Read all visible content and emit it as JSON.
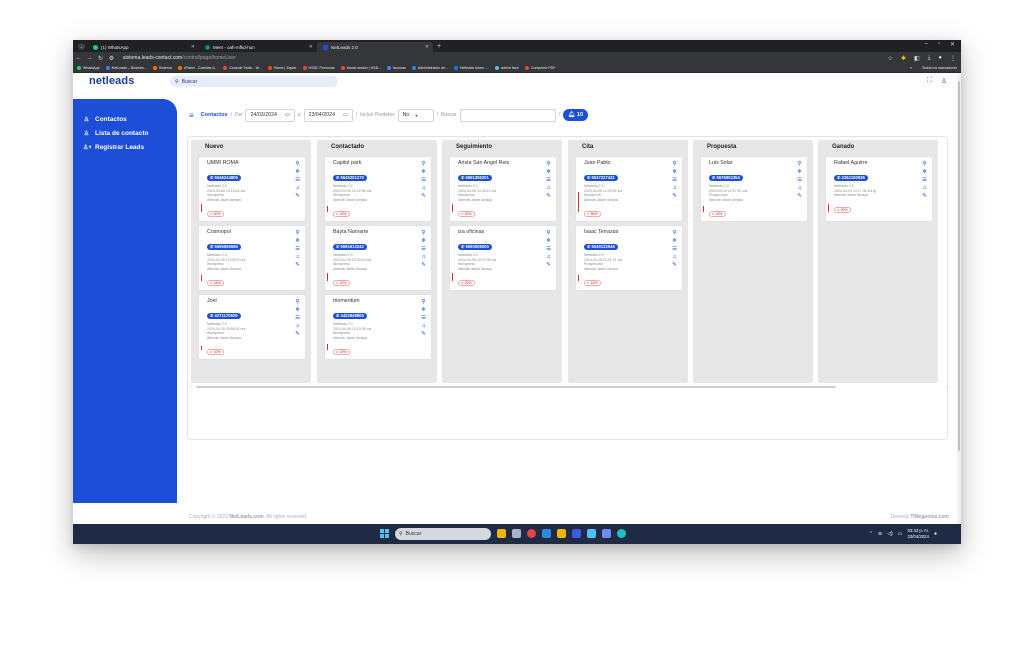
{
  "browser": {
    "tabs": [
      {
        "label": "(1) WhatsApp"
      },
      {
        "label": "Meet - oah-mfkd-hun"
      },
      {
        "label": "NetLeads 2.0"
      }
    ],
    "url_host": "sistema.leads-contact.com",
    "url_path": "/control/page/homeUser",
    "bookmarks": [
      "WhatsApp",
      "NetLeads – Busines...",
      "Sistema",
      "cPanel - Cuentas d...",
      "Console Twilio - W...",
      "Home | Zapier",
      "HSBC Personas",
      "Iniciar sesión | HSB...",
      "facturas",
      "Administrador de...",
      "Netleads token -...",
      "admin face",
      "Comprimir PDF"
    ],
    "bookmarks_right": "Todos los marcadores"
  },
  "app": {
    "logo": "netleads",
    "search_placeholder": "Buscar"
  },
  "sidebar": {
    "items": [
      {
        "label": "Contactos"
      },
      {
        "label": "Lista de contacto"
      },
      {
        "label": "Registrar Leads"
      }
    ]
  },
  "filters": {
    "contactos": "Contactos",
    "slash1": "/",
    "del": "Del",
    "date_from": "24/03/2024",
    "a": "a",
    "date_to": "23/04/2024",
    "slash2": "/",
    "incluir": "Incluir Perdidos",
    "perdidos_value": "No",
    "slash3": "/",
    "buscar": "Buscar",
    "slash4": "/",
    "count": "10"
  },
  "board": {
    "columns": [
      {
        "title": "Nuevo",
        "cards": [
          {
            "name": "UMMI ROMA",
            "phone": "5546244805",
            "source": "Netleads 2.0",
            "date": "2024-04-05 10:15:43 vía",
            "channel": "Wordpress",
            "agent": "Atiende:Javier Amaya",
            "pct": "20%"
          },
          {
            "name": "Cosmopol",
            "phone": "5555555555",
            "source": "Netleads 2.0",
            "date": "2024-04-05 10:25:03 vía",
            "channel": "Wordpress",
            "agent": "Atiende:Javier Amaya",
            "pct": "15%"
          },
          {
            "name": "Joel",
            "phone": "4271170929",
            "source": "Netleads 2.0",
            "date": "2024-04-18 15:59:01 vía",
            "channel": "Wordpress",
            "agent": "Atiende:Javier Amaya",
            "pct": "10%"
          }
        ]
      },
      {
        "title": "Contactado",
        "cards": [
          {
            "name": "Capitol park",
            "phone": "5545201270",
            "source": "Netleads 2.0",
            "date": "2024-04-05 10:22:56 vía",
            "channel": "Wordpress",
            "agent": "Atiende:Javier Amaya",
            "pct": "15%"
          },
          {
            "name": "Bayta Narvarte",
            "phone": "5591613242",
            "source": "Netleads 2.0",
            "date": "2024-04-05 10:20:19 vía",
            "channel": "Wordpress",
            "agent": "Atiende:Javier Amaya",
            "pct": "20%"
          },
          {
            "name": "momentum",
            "phone": "4422948800",
            "source": "Netleads 2.0",
            "date": "2024-04-05 10:10:39 vía",
            "channel": "Wordpress",
            "agent": "Atiende:Javier Amaya",
            "pct": "15%"
          }
        ]
      },
      {
        "title": "Seguimiento",
        "cards": [
          {
            "name": "Arista San Angel Reis",
            "phone": "5591355201",
            "source": "Netleads 2.0",
            "date": "2024-04-05 10:28:13 vía",
            "channel": "Wordpress",
            "agent": "Atiende:Javier Amaya",
            "pct": "20%"
          },
          {
            "name": "iza oficinas",
            "phone": "5560008000",
            "source": "Netleads 2.0",
            "date": "2024-04-05 10:07:03 vía",
            "channel": "Wordpress",
            "agent": "Atiende:Javier Amaya",
            "pct": "20%"
          }
        ]
      },
      {
        "title": "Cita",
        "cards": [
          {
            "name": "Juan Pablo",
            "phone": "5537227431",
            "source": "Netleads 2.0",
            "date": "2024-04-05 12:09:25 vía",
            "channel": "Wordpress",
            "agent": "Atiende:Javier Amaya",
            "pct": "50%"
          },
          {
            "name": "Isaac Terrazas",
            "phone": "5549122945",
            "source": "Netleads 2.0",
            "date": "2024-04-18 22:01:01 vía",
            "channel": "Prospeccion",
            "agent": "Atiende:Javier Amaya",
            "pct": "15%"
          }
        ]
      },
      {
        "title": "Propuesta",
        "cards": [
          {
            "name": "Luis Solar",
            "phone": "5576902354",
            "source": "Netleads 2.0",
            "date": "2024-04-16 12:57:20 vía",
            "channel": "Prospeccion",
            "agent": "Atiende:Javier Amaya",
            "pct": "15%"
          }
        ]
      },
      {
        "title": "Ganado",
        "cards": [
          {
            "name": "Rafael Aguirre",
            "phone": "2262100936",
            "source": "Netleads 2.0",
            "date": "2024-04-03 10:17:36 vía lg",
            "channel": "",
            "agent": "Atiende:Javier Amaya",
            "pct": "20%"
          }
        ]
      }
    ]
  },
  "footer": {
    "copyright": "Copyright © 2022",
    "brand": "NetLeads.com",
    "rights": ". All rights reserved.",
    "dev_prefix": "Develop",
    "dev_brand": "TINegocios.com"
  },
  "taskbar": {
    "search": "Buscar",
    "time": "03:43 p. m.",
    "date": "23/04/2024"
  },
  "colors": {
    "accent": "#1d4ed8",
    "logo": "#1e3a8a",
    "column_bg": "#e7e7e7",
    "taskbar": "#1f2a44"
  }
}
